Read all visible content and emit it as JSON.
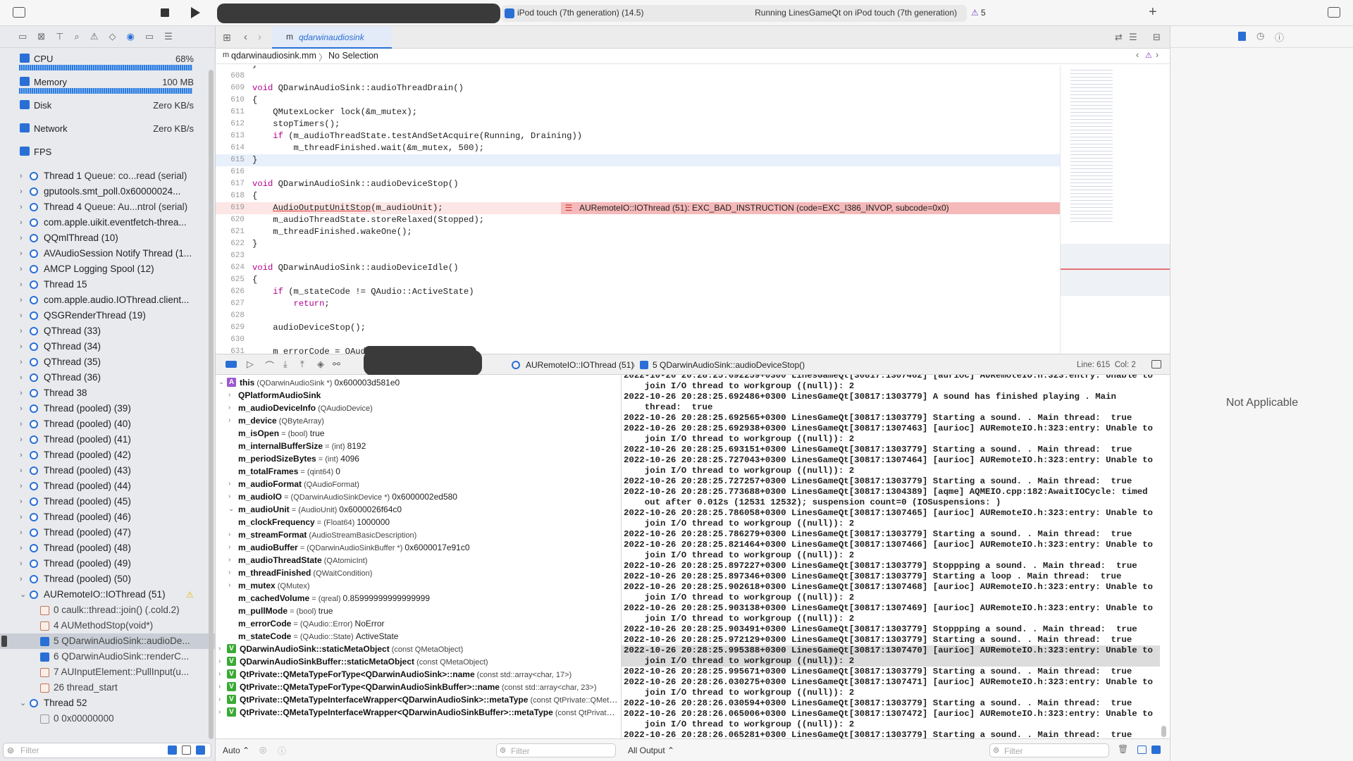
{
  "toolbar": {
    "device": "iPod touch (7th generation) (14.5)",
    "status": "Running LinesGameQt on iPod touch (7th generation)",
    "warnings": "5"
  },
  "gauges": [
    {
      "label": "CPU",
      "value": "68%",
      "fill": 0.68
    },
    {
      "label": "Memory",
      "value": "100 MB",
      "fill": 0.5
    },
    {
      "label": "Disk",
      "value": "Zero KB/s"
    },
    {
      "label": "Network",
      "value": "Zero KB/s"
    },
    {
      "label": "FPS",
      "value": ""
    }
  ],
  "threads": [
    {
      "name": "Thread 1",
      "queue": "Queue: co...read (serial)"
    },
    {
      "name": "gputools.smt_poll.0x60000024...",
      "queue": ""
    },
    {
      "name": "Thread 4",
      "queue": "Queue: Au...ntrol (serial)"
    },
    {
      "name": "com.apple.uikit.eventfetch-threa...",
      "queue": ""
    },
    {
      "name": "QQmlThread (10)",
      "queue": ""
    },
    {
      "name": "AVAudioSession Notify Thread (1...",
      "queue": ""
    },
    {
      "name": "AMCP Logging Spool (12)",
      "queue": ""
    },
    {
      "name": "Thread 15",
      "queue": ""
    },
    {
      "name": "com.apple.audio.IOThread.client...",
      "queue": ""
    },
    {
      "name": "QSGRenderThread (19)",
      "queue": ""
    },
    {
      "name": "QThread (33)",
      "queue": ""
    },
    {
      "name": "QThread (34)",
      "queue": ""
    },
    {
      "name": "QThread (35)",
      "queue": ""
    },
    {
      "name": "QThread (36)",
      "queue": ""
    },
    {
      "name": "Thread 38",
      "queue": ""
    },
    {
      "name": "Thread (pooled) (39)",
      "queue": ""
    },
    {
      "name": "Thread (pooled) (40)",
      "queue": ""
    },
    {
      "name": "Thread (pooled) (41)",
      "queue": ""
    },
    {
      "name": "Thread (pooled) (42)",
      "queue": ""
    },
    {
      "name": "Thread (pooled) (43)",
      "queue": ""
    },
    {
      "name": "Thread (pooled) (44)",
      "queue": ""
    },
    {
      "name": "Thread (pooled) (45)",
      "queue": ""
    },
    {
      "name": "Thread (pooled) (46)",
      "queue": ""
    },
    {
      "name": "Thread (pooled) (47)",
      "queue": ""
    },
    {
      "name": "Thread (pooled) (48)",
      "queue": ""
    },
    {
      "name": "Thread (pooled) (49)",
      "queue": ""
    },
    {
      "name": "Thread (pooled) (50)",
      "queue": ""
    }
  ],
  "crash_thread": {
    "name": "AURemoteIO::IOThread (51)"
  },
  "frames": [
    {
      "label": "0 caulk::thread::join() (.cold.2)",
      "kind": "lib"
    },
    {
      "label": "4 AUMethodStop(void*)",
      "kind": "lib"
    },
    {
      "label": "5 QDarwinAudioSink::audioDe...",
      "kind": "user",
      "selected": true
    },
    {
      "label": "6 QDarwinAudioSink::renderC...",
      "kind": "user"
    },
    {
      "label": "7 AUInputElement::PullInput(u...",
      "kind": "lib"
    },
    {
      "label": "26 thread_start",
      "kind": "lib"
    }
  ],
  "thread52": {
    "name": "Thread 52",
    "frame": "0 0x00000000"
  },
  "left_filter_placeholder": "Filter",
  "editor": {
    "tab": "qdarwinaudiosink",
    "file": "qdarwinaudiosink.mm",
    "selection": "No Selection",
    "error": "AURemoteIO::IOThread (51): EXC_BAD_INSTRUCTION (code=EXC_I386_INVOP, subcode=0x0)",
    "lines": [
      {
        "n": "607",
        "t": "}"
      },
      {
        "n": "608",
        "t": ""
      },
      {
        "n": "609",
        "t": "void QDarwinAudioSink::audioThreadDrain()"
      },
      {
        "n": "610",
        "t": "{"
      },
      {
        "n": "611",
        "t": "    QMutexLocker lock(&m_mutex);"
      },
      {
        "n": "612",
        "t": "    stopTimers();"
      },
      {
        "n": "613",
        "t": "    if (m_audioThreadState.testAndSetAcquire(Running, Draining))"
      },
      {
        "n": "614",
        "t": "        m_threadFinished.wait(&m_mutex, 500);"
      },
      {
        "n": "615",
        "t": "}"
      },
      {
        "n": "616",
        "t": ""
      },
      {
        "n": "617",
        "t": "void QDarwinAudioSink::audioDeviceStop()"
      },
      {
        "n": "618",
        "t": "{"
      },
      {
        "n": "619",
        "t": "    AudioOutputUnitStop(m_audioUnit);"
      },
      {
        "n": "620",
        "t": "    m_audioThreadState.storeRelaxed(Stopped);"
      },
      {
        "n": "621",
        "t": "    m_threadFinished.wakeOne();"
      },
      {
        "n": "622",
        "t": "}"
      },
      {
        "n": "623",
        "t": ""
      },
      {
        "n": "624",
        "t": "void QDarwinAudioSink::audioDeviceIdle()"
      },
      {
        "n": "625",
        "t": "{"
      },
      {
        "n": "626",
        "t": "    if (m_stateCode != QAudio::ActiveState)"
      },
      {
        "n": "627",
        "t": "        return;"
      },
      {
        "n": "628",
        "t": ""
      },
      {
        "n": "629",
        "t": "    audioDeviceStop();"
      },
      {
        "n": "630",
        "t": ""
      },
      {
        "n": "631",
        "t": "    m_errorCode = QAud"
      }
    ]
  },
  "debugbar": {
    "thread": "AURemoteIO::IOThread (51)",
    "frame": "5 QDarwinAudioSink::audioDeviceStop()",
    "position": "Line: 615  Col: 2"
  },
  "variables": [
    {
      "d": 0,
      "ch": "v",
      "badge": "A",
      "bc": "#9b59d0",
      "name": "this",
      "type": "(QDarwinAudioSink *)",
      "val": "0x600003d581e0"
    },
    {
      "d": 1,
      "ch": ">",
      "name": "QPlatformAudioSink",
      "type": "",
      "val": ""
    },
    {
      "d": 1,
      "ch": ">",
      "name": "m_audioDeviceInfo",
      "type": "(QAudioDevice)",
      "val": ""
    },
    {
      "d": 1,
      "ch": ">",
      "name": "m_device",
      "type": "(QByteArray)",
      "val": ""
    },
    {
      "d": 1,
      "ch": "",
      "name": "m_isOpen",
      "type": "= (bool)",
      "val": "true"
    },
    {
      "d": 1,
      "ch": "",
      "name": "m_internalBufferSize",
      "type": "= (int)",
      "val": "8192"
    },
    {
      "d": 1,
      "ch": "",
      "name": "m_periodSizeBytes",
      "type": "= (int)",
      "val": "4096"
    },
    {
      "d": 1,
      "ch": "",
      "name": "m_totalFrames",
      "type": "= (qint64)",
      "val": "0"
    },
    {
      "d": 1,
      "ch": ">",
      "name": "m_audioFormat",
      "type": "(QAudioFormat)",
      "val": ""
    },
    {
      "d": 1,
      "ch": ">",
      "name": "m_audioIO",
      "type": "= (QDarwinAudioSinkDevice *)",
      "val": "0x6000002ed580"
    },
    {
      "d": 1,
      "ch": "v",
      "name": "m_audioUnit",
      "type": "= (AudioUnit)",
      "val": "0x6000026f64c0"
    },
    {
      "d": 1,
      "ch": "",
      "name": "m_clockFrequency",
      "type": "= (Float64)",
      "val": "1000000"
    },
    {
      "d": 1,
      "ch": ">",
      "name": "m_streamFormat",
      "type": "(AudioStreamBasicDescription)",
      "val": ""
    },
    {
      "d": 1,
      "ch": ">",
      "name": "m_audioBuffer",
      "type": "= (QDarwinAudioSinkBuffer *)",
      "val": "0x6000017e91c0"
    },
    {
      "d": 1,
      "ch": ">",
      "name": "m_audioThreadState",
      "type": "(QAtomicInt)",
      "val": ""
    },
    {
      "d": 1,
      "ch": ">",
      "name": "m_threadFinished",
      "type": "(QWaitCondition)",
      "val": ""
    },
    {
      "d": 1,
      "ch": ">",
      "name": "m_mutex",
      "type": "(QMutex)",
      "val": ""
    },
    {
      "d": 1,
      "ch": "",
      "name": "m_cachedVolume",
      "type": "= (qreal)",
      "val": "0.85999999999999999"
    },
    {
      "d": 1,
      "ch": "",
      "name": "m_pullMode",
      "type": "= (bool)",
      "val": "true"
    },
    {
      "d": 1,
      "ch": "",
      "name": "m_errorCode",
      "type": "= (QAudio::Error)",
      "val": "NoError"
    },
    {
      "d": 1,
      "ch": "",
      "name": "m_stateCode",
      "type": "= (QAudio::State)",
      "val": "ActiveState"
    },
    {
      "d": 0,
      "ch": ">",
      "badge": "V",
      "bc": "#3aaa35",
      "name": "QDarwinAudioSink::staticMetaObject",
      "type": "(const QMetaObject)",
      "val": ""
    },
    {
      "d": 0,
      "ch": ">",
      "badge": "V",
      "bc": "#3aaa35",
      "name": "QDarwinAudioSinkBuffer::staticMetaObject",
      "type": "(const QMetaObject)",
      "val": ""
    },
    {
      "d": 0,
      "ch": ">",
      "badge": "V",
      "bc": "#3aaa35",
      "name": "QtPrivate::QMetaTypeForType<QDarwinAudioSink>::name",
      "type": "(const std::array<char, 17>)",
      "val": ""
    },
    {
      "d": 0,
      "ch": ">",
      "badge": "V",
      "bc": "#3aaa35",
      "name": "QtPrivate::QMetaTypeForType<QDarwinAudioSinkBuffer>::name",
      "type": "(const std::array<char, 23>)",
      "val": ""
    },
    {
      "d": 0,
      "ch": ">",
      "badge": "V",
      "bc": "#3aaa35",
      "name": "QtPrivate::QMetaTypeInterfaceWrapper<QDarwinAudioSink>::metaType",
      "type": "(const QtPrivate::QMetaTy...",
      "val": ""
    },
    {
      "d": 0,
      "ch": ">",
      "badge": "V",
      "bc": "#3aaa35",
      "name": "QtPrivate::QMetaTypeInterfaceWrapper<QDarwinAudioSinkBuffer>::metaType",
      "type": "(const QtPrivate::Q...",
      "val": ""
    }
  ],
  "console": [
    {
      "t": "2022-10-26 20:28:25.692259+0300 LinesGameQt[30817:1307462] [aurioc] AURemoteIO.h:323:entry: Unable to"
    },
    {
      "t": "    join I/O thread to workgroup ((null)): 2"
    },
    {
      "t": "2022-10-26 20:28:25.692486+0300 LinesGameQt[30817:1303779] A sound has finished playing . Main"
    },
    {
      "t": "    thread:  true"
    },
    {
      "t": "2022-10-26 20:28:25.692565+0300 LinesGameQt[30817:1303779] Starting a sound. . Main thread:  true"
    },
    {
      "t": "2022-10-26 20:28:25.692938+0300 LinesGameQt[30817:1307463] [aurioc] AURemoteIO.h:323:entry: Unable to"
    },
    {
      "t": "    join I/O thread to workgroup ((null)): 2"
    },
    {
      "t": "2022-10-26 20:28:25.693151+0300 LinesGameQt[30817:1303779] Starting a sound. . Main thread:  true"
    },
    {
      "t": "2022-10-26 20:28:25.727043+0300 LinesGameQt[30817:1307464] [aurioc] AURemoteIO.h:323:entry: Unable to"
    },
    {
      "t": "    join I/O thread to workgroup ((null)): 2"
    },
    {
      "t": "2022-10-26 20:28:25.727257+0300 LinesGameQt[30817:1303779] Starting a sound. . Main thread:  true"
    },
    {
      "t": "2022-10-26 20:28:25.773688+0300 LinesGameQt[30817:1304389] [aqme] AQMEIO.cpp:182:AwaitIOCycle: timed"
    },
    {
      "t": "    out after 0.012s (12531 12532); suspension count=0 (IOSuspensions: )"
    },
    {
      "t": "2022-10-26 20:28:25.786058+0300 LinesGameQt[30817:1307465] [aurioc] AURemoteIO.h:323:entry: Unable to"
    },
    {
      "t": "    join I/O thread to workgroup ((null)): 2"
    },
    {
      "t": "2022-10-26 20:28:25.786279+0300 LinesGameQt[30817:1303779] Starting a sound. . Main thread:  true"
    },
    {
      "t": "2022-10-26 20:28:25.821464+0300 LinesGameQt[30817:1307466] [aurioc] AURemoteIO.h:323:entry: Unable to"
    },
    {
      "t": "    join I/O thread to workgroup ((null)): 2"
    },
    {
      "t": "2022-10-26 20:28:25.897227+0300 LinesGameQt[30817:1303779] Stoppping a sound. . Main thread:  true"
    },
    {
      "t": "2022-10-26 20:28:25.897346+0300 LinesGameQt[30817:1303779] Starting a loop . Main thread:  true"
    },
    {
      "t": "2022-10-26 20:28:25.902618+0300 LinesGameQt[30817:1307468] [aurioc] AURemoteIO.h:323:entry: Unable to"
    },
    {
      "t": "    join I/O thread to workgroup ((null)): 2"
    },
    {
      "t": "2022-10-26 20:28:25.903138+0300 LinesGameQt[30817:1307469] [aurioc] AURemoteIO.h:323:entry: Unable to"
    },
    {
      "t": "    join I/O thread to workgroup ((null)): 2"
    },
    {
      "t": "2022-10-26 20:28:25.903491+0300 LinesGameQt[30817:1303779] Stoppping a sound. . Main thread:  true"
    },
    {
      "t": "2022-10-26 20:28:25.972129+0300 LinesGameQt[30817:1303779] Starting a sound. . Main thread:  true"
    },
    {
      "t": "2022-10-26 20:28:25.995388+0300 LinesGameQt[30817:1307470] [aurioc] AURemoteIO.h:323:entry: Unable to",
      "hl": true
    },
    {
      "t": "    join I/O thread to workgroup ((null)): 2",
      "hl": true
    },
    {
      "t": "2022-10-26 20:28:25.995671+0300 LinesGameQt[30817:1303779] Starting a sound. . Main thread:  true"
    },
    {
      "t": "2022-10-26 20:28:26.030275+0300 LinesGameQt[30817:1307471] [aurioc] AURemoteIO.h:323:entry: Unable to"
    },
    {
      "t": "    join I/O thread to workgroup ((null)): 2"
    },
    {
      "t": "2022-10-26 20:28:26.030594+0300 LinesGameQt[30817:1303779] Starting a sound. . Main thread:  true"
    },
    {
      "t": "2022-10-26 20:28:26.065006+0300 LinesGameQt[30817:1307472] [aurioc] AURemoteIO.h:323:entry: Unable to"
    },
    {
      "t": "    join I/O thread to workgroup ((null)): 2"
    },
    {
      "t": "2022-10-26 20:28:26.065281+0300 LinesGameQt[30817:1303779] Starting a sound. . Main thread:  true"
    }
  ],
  "bottombar": {
    "auto": "Auto ⌃",
    "filter_placeholder": "Filter",
    "output": "All Output ⌃",
    "console_filter_placeholder": "Filter"
  },
  "inspector": {
    "empty": "Not Applicable"
  }
}
